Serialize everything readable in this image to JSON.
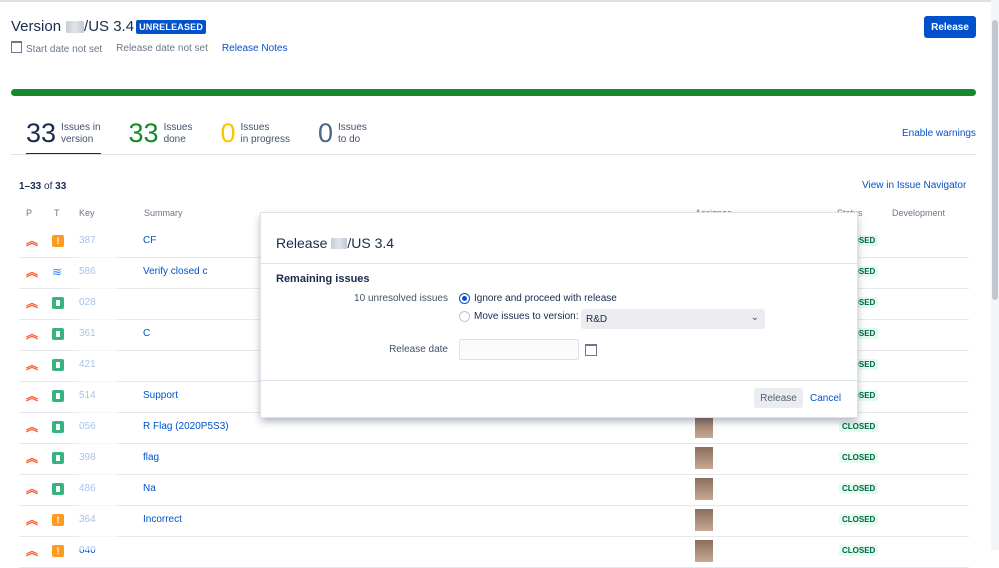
{
  "header": {
    "title_prefix": "Version",
    "title_suffix": "/US 3.4",
    "badge": "UNRELEASED",
    "start_date": "Start date not set",
    "release_date": "Release date not set",
    "release_notes": "Release Notes",
    "release_button": "Release"
  },
  "progress": {
    "done_fraction": 1.0,
    "color": "#14892c"
  },
  "stats": [
    {
      "num": "33",
      "label1": "Issues in",
      "label2": "version",
      "color": "#172b4d"
    },
    {
      "num": "33",
      "label1": "Issues",
      "label2": "done",
      "color": "#14892c"
    },
    {
      "num": "0",
      "label1": "Issues",
      "label2": "in progress",
      "color": "#ffc400"
    },
    {
      "num": "0",
      "label1": "Issues",
      "label2": "to do",
      "color": "#4a6785"
    }
  ],
  "enable_warnings": "Enable warnings",
  "list": {
    "count_range": "1–33",
    "count_of": "of",
    "count_total": "33",
    "view_in_navigator": "View in Issue Navigator",
    "columns": {
      "p": "P",
      "t": "T",
      "key": "Key",
      "summary": "Summary",
      "assignee": "Assignee",
      "status": "Status",
      "development": "Development"
    },
    "rows": [
      {
        "key": "387",
        "summary": "CF",
        "type": "bug",
        "status": "CLOSED"
      },
      {
        "key": "586",
        "summary": "Verify closed c",
        "type": "task",
        "status": "CLOSED"
      },
      {
        "key": "028",
        "summary": "",
        "type": "story",
        "status": "CLOSED"
      },
      {
        "key": "361",
        "summary": "C",
        "type": "story",
        "status": "CLOSED"
      },
      {
        "key": "421",
        "summary": "",
        "type": "story",
        "status": "CLOSED"
      },
      {
        "key": "514",
        "summary": "Support",
        "type": "story",
        "status": "CLOSED"
      },
      {
        "key": "056",
        "summary": "R Flag (2020P5S3)",
        "type": "story",
        "status": "CLOSED"
      },
      {
        "key": "398",
        "summary": "flag",
        "type": "story",
        "status": "CLOSED"
      },
      {
        "key": "486",
        "summary": "Na",
        "type": "story",
        "status": "CLOSED"
      },
      {
        "key": "364",
        "summary": "Incorrect",
        "type": "bug",
        "status": "CLOSED"
      },
      {
        "key": "040",
        "summary": "",
        "type": "bug",
        "status": "CLOSED"
      }
    ]
  },
  "dialog": {
    "title_prefix": "Release",
    "title_suffix": "/US 3.4",
    "subhead": "Remaining issues",
    "unresolved_label": "10 unresolved issues",
    "option_ignore": "Ignore and proceed with release",
    "option_move": "Move issues to version:",
    "move_version_value": "R&D",
    "release_date_label": "Release date",
    "release_date_value": "",
    "release_button": "Release",
    "cancel_link": "Cancel"
  }
}
